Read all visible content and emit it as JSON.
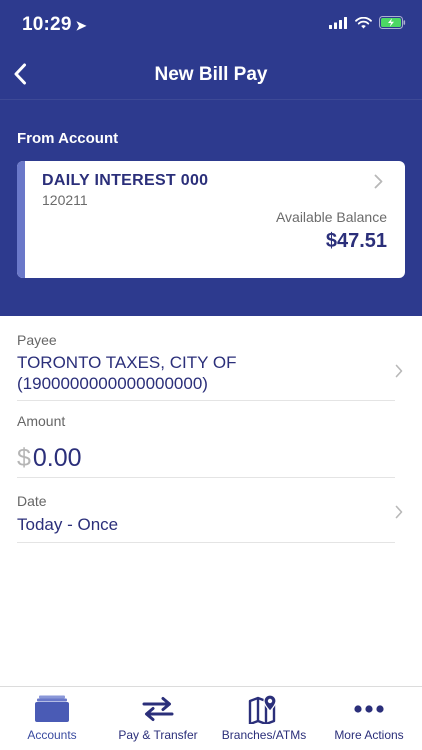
{
  "status_bar": {
    "time": "10:29"
  },
  "header": {
    "title": "New Bill Pay"
  },
  "from_account": {
    "section_label": "From Account",
    "name": "DAILY INTEREST 000",
    "number": "120211",
    "balance_label": "Available Balance",
    "balance_value": "$47.51"
  },
  "payee": {
    "label": "Payee",
    "value_line1": "TORONTO TAXES, CITY OF",
    "value_line2": "(1900000000000000000)"
  },
  "amount": {
    "label": "Amount",
    "currency": "$",
    "value": "0.00"
  },
  "date": {
    "label": "Date",
    "value": "Today - Once"
  },
  "tabs": [
    {
      "label": "Accounts",
      "icon": "accounts-icon",
      "active": true
    },
    {
      "label": "Pay & Transfer",
      "icon": "transfer-arrows-icon",
      "active": false
    },
    {
      "label": "Branches/ATMs",
      "icon": "map-pin-icon",
      "active": false
    },
    {
      "label": "More Actions",
      "icon": "ellipsis-icon",
      "active": false
    }
  ],
  "colors": {
    "primary": "#2d3a8e",
    "accent_stripe": "#6a78c9",
    "text_primary": "#2b2f7a",
    "battery_green": "#4cd964"
  }
}
